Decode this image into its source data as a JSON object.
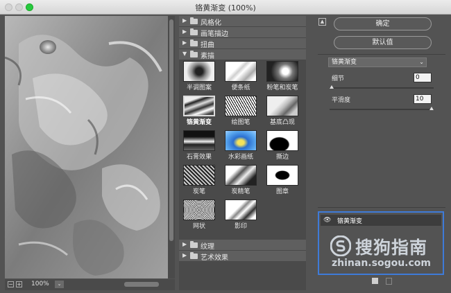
{
  "window": {
    "title": "铬黄渐变 (100%)"
  },
  "preview": {
    "zoom": "100%",
    "zoom_out": "−",
    "zoom_in": "+",
    "zoom_dd": "⌄"
  },
  "gallery": {
    "categories_top": [
      {
        "label": "风格化",
        "arrow": "▶"
      },
      {
        "label": "画笔描边",
        "arrow": "▶"
      },
      {
        "label": "扭曲",
        "arrow": "▶"
      },
      {
        "label": "素描",
        "arrow": "▼"
      }
    ],
    "filters": [
      {
        "label": "半调图案",
        "selected": false
      },
      {
        "label": "便条纸",
        "selected": false
      },
      {
        "label": "粉笔和炭笔",
        "selected": false
      },
      {
        "label": "铬黄渐变",
        "selected": true
      },
      {
        "label": "绘图笔",
        "selected": false
      },
      {
        "label": "基底凸现",
        "selected": false
      },
      {
        "label": "石膏效果",
        "selected": false
      },
      {
        "label": "水彩画纸",
        "selected": false
      },
      {
        "label": "撕边",
        "selected": false
      },
      {
        "label": "炭笔",
        "selected": false
      },
      {
        "label": "炭精笔",
        "selected": false
      },
      {
        "label": "图章",
        "selected": false
      },
      {
        "label": "网状",
        "selected": false
      },
      {
        "label": "影印",
        "selected": false
      }
    ],
    "categories_bottom": [
      {
        "label": "纹理",
        "arrow": "▶"
      },
      {
        "label": "艺术效果",
        "arrow": "▶"
      }
    ]
  },
  "buttons": {
    "ok": "确定",
    "default": "默认值",
    "collapse": "▲"
  },
  "settings": {
    "filter": "铬黄渐变",
    "filter_dd": "⌄",
    "detail": {
      "label": "细节",
      "value": "0",
      "fraction": 0.0
    },
    "smoothness": {
      "label": "平滑度",
      "value": "10",
      "fraction": 1.0
    }
  },
  "layers": {
    "name": "铬黄渐变",
    "eye": "👁"
  },
  "watermark": {
    "text": "搜狗指南",
    "url": "zhinan.sogou.com"
  },
  "colors": {
    "selection_border": "#3e7bd9",
    "panel_bg": "#535353",
    "accent_green": "#27c93f"
  }
}
